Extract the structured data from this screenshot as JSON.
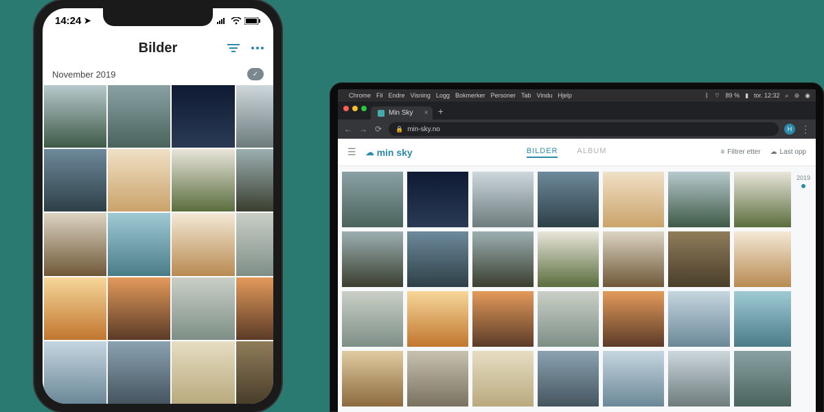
{
  "phone": {
    "status": {
      "time": "14:24",
      "location_icon": "location-arrow",
      "signal_icon": "cell-signal",
      "wifi_icon": "wifi",
      "battery_icon": "battery"
    },
    "header": {
      "title": "Bilder",
      "filter_icon": "filter-lines",
      "more_icon": "more-dots"
    },
    "section": {
      "label": "November 2019",
      "sync_icon": "cloud-check"
    }
  },
  "laptop": {
    "menubar": {
      "apple_icon": "apple-logo",
      "items": [
        "Chrome",
        "Fil",
        "Endre",
        "Visning",
        "Logg",
        "Bokmerker",
        "Personer",
        "Tab",
        "Vindu",
        "Hjelp"
      ],
      "right": {
        "battery_pct": "89 %",
        "datetime": "tor. 12:32"
      }
    },
    "browser": {
      "tab_title": "Min Sky",
      "url": "min-sky.no",
      "avatar_initial": "H"
    },
    "site": {
      "brand": "min sky",
      "tabs": {
        "bilder": "BILDER",
        "album": "ALBUM"
      },
      "filter_label": "Filtrer etter",
      "upload_label": "Last opp",
      "year": "2019"
    }
  }
}
